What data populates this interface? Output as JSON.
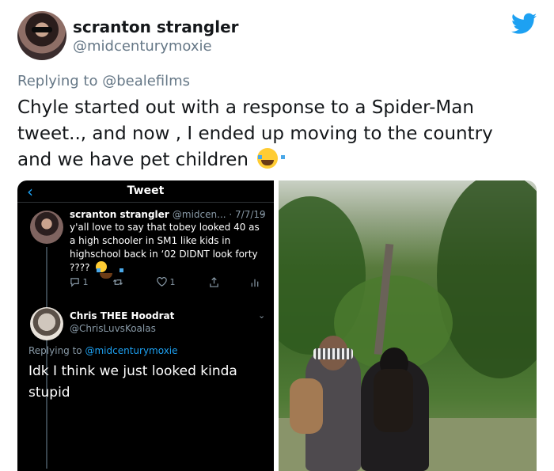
{
  "author": {
    "display_name": "scranton strangler",
    "handle": "@midcenturymoxie"
  },
  "tweet": {
    "replying_prefix": "Replying to ",
    "replying_to": "@bealefilms",
    "text": "Chyle started out with a response to a Spider-Man tweet.., and now , I ended up moving to the country and we have pet children"
  },
  "embedded": {
    "header_title": "Tweet",
    "original": {
      "name": "scranton strangler",
      "meta": "@midcen... · 7/7/19",
      "text": "y'all love to say that tobey looked 40 as a high schooler in SM1 like kids in highschool back in ‘02 DIDNT look forty ????",
      "reply_count": "1",
      "like_count": "1"
    },
    "reply": {
      "name": "Chris THEE Hoodrat",
      "handle": "@ChrisLuvsKoalas",
      "replying_prefix": "Replying to ",
      "replying_to": "@midcenturymoxie",
      "text": "Idk I think we just looked kinda stupid"
    }
  },
  "colors": {
    "twitter_blue": "#1da1f2",
    "gray_text": "#657786",
    "dark_bg": "#000000"
  },
  "icons": [
    "twitter-bird-icon",
    "back-chevron-icon",
    "reply-icon",
    "retweet-icon",
    "like-icon",
    "share-icon",
    "analytics-icon",
    "chevron-down-icon",
    "laughing-crying-emoji"
  ]
}
